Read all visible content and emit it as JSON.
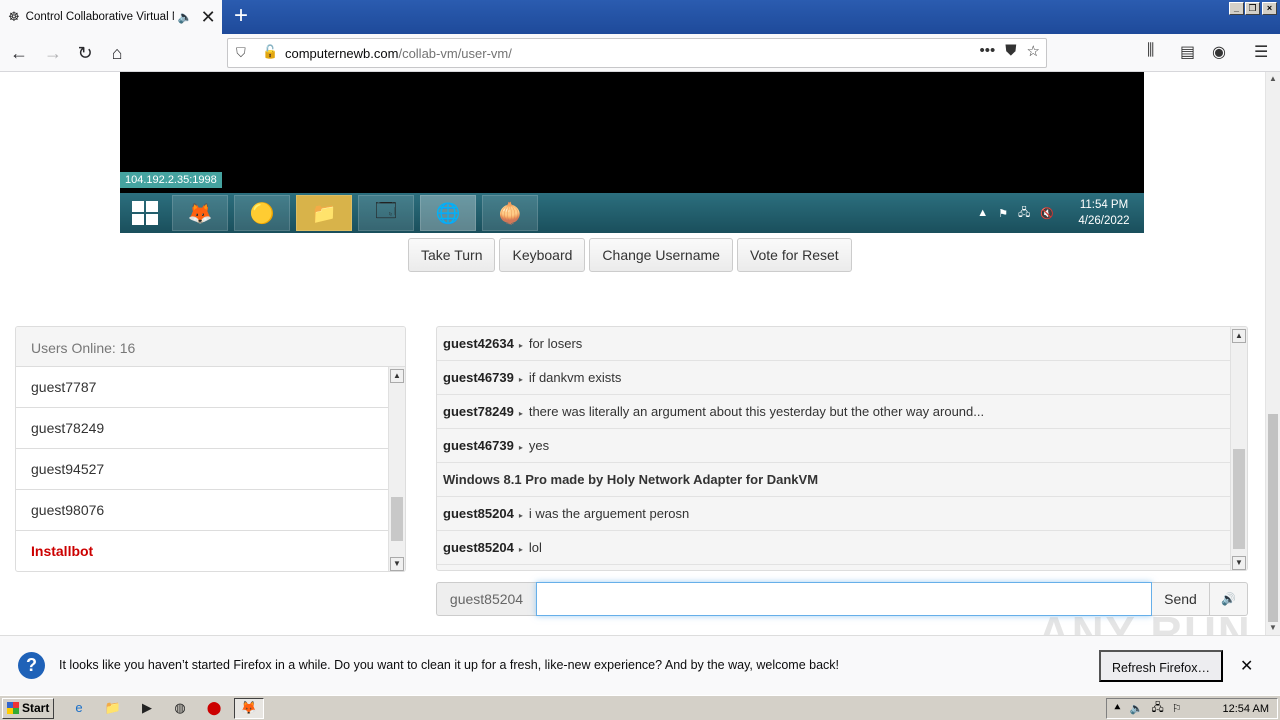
{
  "browser": {
    "tab_title": "Control Collaborative Virtual M",
    "new_tab": "+",
    "url_host": "computernewb.com",
    "url_path": "/collab-vm/user-vm/"
  },
  "vm": {
    "ip": "104.192.2.35:1998",
    "clock_time": "11:54 PM",
    "clock_date": "4/26/2022",
    "buttons": {
      "take_turn": "Take Turn",
      "keyboard": "Keyboard",
      "change_username": "Change Username",
      "vote_reset": "Vote for Reset"
    }
  },
  "users": {
    "header": "Users Online: 16",
    "list": [
      "guest7787",
      "guest78249",
      "guest94527",
      "guest98076",
      "Installbot"
    ]
  },
  "chat": {
    "messages": [
      {
        "user": "guest42634",
        "text": "for losers"
      },
      {
        "user": "guest46739",
        "text": "if dankvm exists"
      },
      {
        "user": "guest78249",
        "text": "there was literally an argument about this yesterday but the other way around..."
      },
      {
        "user": "guest46739",
        "text": "yes"
      },
      {
        "system": "Windows 8.1 Pro made by Holy Network Adapter for DankVM"
      },
      {
        "user": "guest85204",
        "text": "i was the arguement perosn"
      },
      {
        "user": "guest85204",
        "text": "lol"
      }
    ],
    "username": "guest85204",
    "input_value": "",
    "send": "Send"
  },
  "notification": {
    "text": "It looks like you haven’t started Firefox in a while. Do you want to clean it up for a fresh, like-new experience? And by the way, welcome back!",
    "button": "Refresh Firefox…"
  },
  "watermark": "ANY RUN",
  "taskbar": {
    "start": "Start",
    "clock": "12:54 AM"
  }
}
